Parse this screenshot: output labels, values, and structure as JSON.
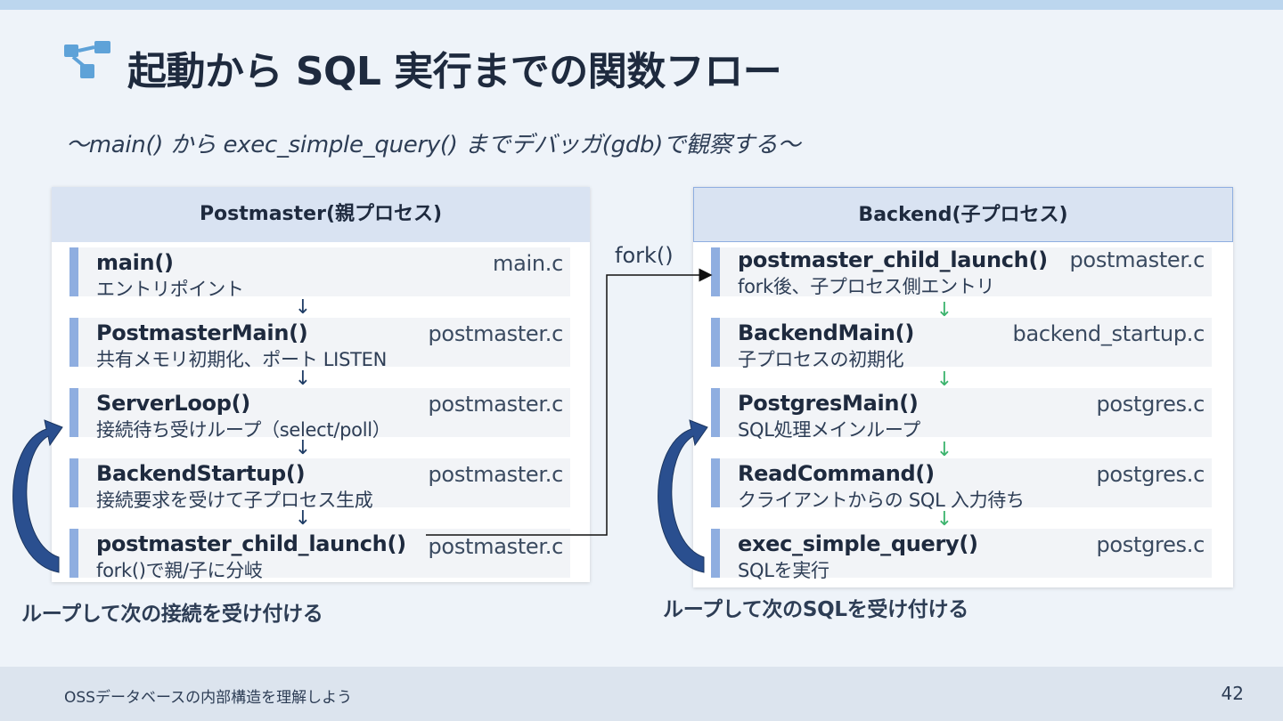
{
  "header": {
    "title": "起動から SQL 実行までの関数フロー",
    "subtitle": "〜main() から exec_simple_query() までデバッガ(gdb)で観察する〜"
  },
  "left_panel": {
    "title": "Postmaster(親プロセス)",
    "steps": [
      {
        "name": "main()",
        "desc": "エントリポイント",
        "file": "main.c"
      },
      {
        "name": "PostmasterMain()",
        "desc": "共有メモリ初期化、ポート LISTEN",
        "file": "postmaster.c"
      },
      {
        "name": "ServerLoop()",
        "desc": "接続待ち受けループ（select/poll）",
        "file": "postmaster.c"
      },
      {
        "name": "BackendStartup()",
        "desc": "接続要求を受けて子プロセス生成",
        "file": "postmaster.c"
      },
      {
        "name": "postmaster_child_launch()",
        "desc": "fork()で親/子に分岐",
        "file": "postmaster.c"
      }
    ],
    "loop_caption": "ループして次の接続を受け付ける"
  },
  "right_panel": {
    "title": "Backend(子プロセス)",
    "steps": [
      {
        "name": "postmaster_child_launch()",
        "desc": "fork後、子プロセス側エントリ",
        "file": "postmaster.c"
      },
      {
        "name": "BackendMain()",
        "desc": "子プロセスの初期化",
        "file": "backend_startup.c"
      },
      {
        "name": "PostgresMain()",
        "desc": "SQL処理メインループ",
        "file": "postgres.c"
      },
      {
        "name": "ReadCommand()",
        "desc": "クライアントからの SQL 入力待ち",
        "file": "postgres.c"
      },
      {
        "name": "exec_simple_query()",
        "desc": "SQLを実行",
        "file": "postgres.c"
      }
    ],
    "loop_caption": "ループして次のSQLを受け付ける"
  },
  "fork_label": "fork()",
  "arrow_glyph": "↓",
  "footer": {
    "text": "OSSデータベースの内部構造を理解しよう",
    "page_number": "42"
  },
  "colors": {
    "background": "#eef3f9",
    "accent_bar": "#8faee0",
    "loop_arrow": "#2a4f8f",
    "green_arrow": "#3cb46e",
    "icon": "#5ea2d8"
  },
  "icons": {
    "title_icon": "flow-diagram-icon"
  }
}
